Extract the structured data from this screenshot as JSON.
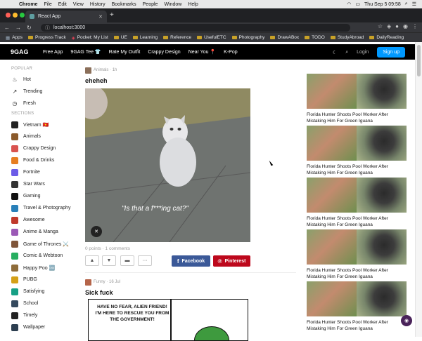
{
  "menubar": {
    "apple": "",
    "items": [
      "Chrome",
      "File",
      "Edit",
      "View",
      "History",
      "Bookmarks",
      "People",
      "Window",
      "Help"
    ],
    "clock": "Thu Sep 5  09:58"
  },
  "browser": {
    "tab_title": "React App",
    "url": "localhost:3000",
    "bookmarks": [
      "Apps",
      "Progress Track",
      "Pocket: My List",
      "UE",
      "Learning",
      "Reference",
      "UsefulETC",
      "Photography",
      "DrawABox",
      "TODO",
      "StudyAbroad",
      "DailyReading"
    ]
  },
  "header": {
    "logo": "9GAG",
    "nav": [
      "Free App",
      "9GAG Tee 👕",
      "Rate My Outfit",
      "Crappy Design",
      "Near You 📍",
      "K-Pop"
    ],
    "login": "Login",
    "signup": "Sign up"
  },
  "sidebar": {
    "popular_heading": "POPULAR",
    "popular": [
      {
        "label": "Hot",
        "icon": "flame-icon"
      },
      {
        "label": "Trending",
        "icon": "trending-icon"
      },
      {
        "label": "Fresh",
        "icon": "clock-icon"
      }
    ],
    "sections_heading": "SECTIONS",
    "sections": [
      {
        "label": "Vietnam 🇻🇳",
        "color": "#222222"
      },
      {
        "label": "Animals",
        "color": "#8b5a2b"
      },
      {
        "label": "Crappy Design",
        "color": "#d9534f"
      },
      {
        "label": "Food & Drinks",
        "color": "#e67e22"
      },
      {
        "label": "Fortnite",
        "color": "#6c5ce7"
      },
      {
        "label": "Star Wars",
        "color": "#333333"
      },
      {
        "label": "Gaming",
        "color": "#111111"
      },
      {
        "label": "Travel & Photography",
        "color": "#2980b9"
      },
      {
        "label": "Awesome",
        "color": "#c0392b"
      },
      {
        "label": "Anime & Manga",
        "color": "#9b59b6"
      },
      {
        "label": "Game of Thrones ⚔️",
        "color": "#7f5539"
      },
      {
        "label": "Comic & Webtoon",
        "color": "#27ae60"
      },
      {
        "label": "Happy Poo 🆒",
        "color": "#8e6c3a"
      },
      {
        "label": "PUBG",
        "color": "#d4a017"
      },
      {
        "label": "Satisfying",
        "color": "#16a085"
      },
      {
        "label": "School",
        "color": "#34495e"
      },
      {
        "label": "Timely",
        "color": "#222222"
      },
      {
        "label": "Wallpaper",
        "color": "#2c3e50"
      }
    ]
  },
  "posts": [
    {
      "section": "Animals",
      "time": "1h",
      "title": "eheheh",
      "caption": "\"Is that a f***ing cat?\"",
      "stats": "0 points · 1 comments",
      "facebook": "Facebook",
      "pinterest": "Pinterest"
    },
    {
      "section": "Funny",
      "time": "16 Jul",
      "title": "Sick fuck",
      "comic_text": "HAVE NO FEAR, ALIEN FRIEND! I'M HERE TO RESCUE YOU FROM THE GOVERNMENT!"
    }
  ],
  "featured": [
    {
      "title": "Florida Hunter Shoots Pool Worker After Mistaking Him For Green Iguana"
    },
    {
      "title": "Florida Hunter Shoots Pool Worker After Mistaking Him For Green Iguana"
    },
    {
      "title": "Florida Hunter Shoots Pool Worker After Mistaking Him For Green Iguana"
    },
    {
      "title": "Florida Hunter Shoots Pool Worker After Mistaking Him For Green Iguana"
    },
    {
      "title": "Florida Hunter Shoots Pool Worker After Mistaking Him For Green Iguana"
    }
  ],
  "colors": {
    "brand_black": "#000000",
    "signup_blue": "#0099ff",
    "facebook": "#3b5998",
    "pinterest": "#bd081c"
  }
}
